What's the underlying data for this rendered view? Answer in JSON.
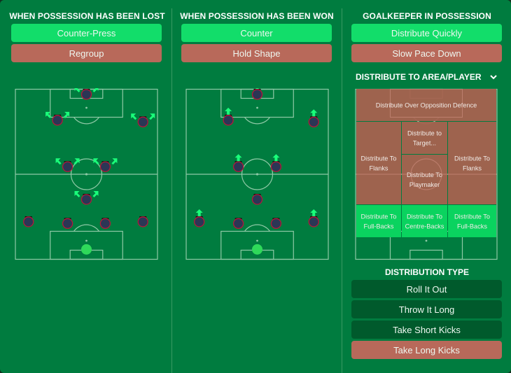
{
  "colors": {
    "background": "#007c3f",
    "selected": "#12dd6a",
    "unselected": "#b8695a",
    "neutral": "#005a2c",
    "pitch_line": "#8fc9a6",
    "player_fill": "#2b3655",
    "player_ring": "#b3183a",
    "gk_fill": "#2fd95a",
    "arrow": "#1aff7a"
  },
  "lost": {
    "title": "WHEN POSSESSION HAS BEEN LOST",
    "options": [
      {
        "label": "Counter-Press",
        "selected": true
      },
      {
        "label": "Regroup",
        "selected": false
      }
    ],
    "players": [
      {
        "role": "striker",
        "arrows": "diag"
      },
      {
        "role": "left-attacker",
        "arrows": "diag"
      },
      {
        "role": "right-attacker",
        "arrows": "diag"
      },
      {
        "role": "left-centre-mid",
        "arrows": "diag"
      },
      {
        "role": "right-centre-mid",
        "arrows": "diag"
      },
      {
        "role": "defensive-mid",
        "arrows": "diag"
      },
      {
        "role": "left-back",
        "arrows": "none"
      },
      {
        "role": "left-centre-back",
        "arrows": "none"
      },
      {
        "role": "right-centre-back",
        "arrows": "none"
      },
      {
        "role": "right-back",
        "arrows": "none"
      },
      {
        "role": "goalkeeper",
        "arrows": "none"
      }
    ]
  },
  "won": {
    "title": "WHEN POSSESSION HAS BEEN WON",
    "options": [
      {
        "label": "Counter",
        "selected": true
      },
      {
        "label": "Hold Shape",
        "selected": false
      }
    ],
    "players": [
      {
        "role": "striker",
        "arrows": "up"
      },
      {
        "role": "left-attacker",
        "arrows": "up"
      },
      {
        "role": "right-attacker",
        "arrows": "up"
      },
      {
        "role": "left-centre-mid",
        "arrows": "up"
      },
      {
        "role": "right-centre-mid",
        "arrows": "up"
      },
      {
        "role": "defensive-mid",
        "arrows": "none"
      },
      {
        "role": "left-back",
        "arrows": "up"
      },
      {
        "role": "left-centre-back",
        "arrows": "none"
      },
      {
        "role": "right-centre-back",
        "arrows": "none"
      },
      {
        "role": "right-back",
        "arrows": "up"
      },
      {
        "role": "goalkeeper",
        "arrows": "none"
      }
    ]
  },
  "goalkeeper": {
    "title": "GOALKEEPER IN POSSESSION",
    "options": [
      {
        "label": "Distribute Quickly",
        "selected": true
      },
      {
        "label": "Slow Pace Down",
        "selected": false
      }
    ],
    "distribute_area": {
      "title": "DISTRIBUTE TO AREA/PLAYER",
      "chevron_icon": "chevron-down-icon",
      "zones": {
        "over_defence": {
          "lines": [
            "Distribute Over Opposition Defence"
          ],
          "selected": false
        },
        "left_flank": {
          "lines": [
            "Distribute To",
            "Flanks"
          ],
          "selected": false
        },
        "target": {
          "lines": [
            "Distribute to",
            "Target..."
          ],
          "selected": false
        },
        "playmaker": {
          "lines": [
            "Distribute To",
            "Playmaker"
          ],
          "selected": false
        },
        "right_flank": {
          "lines": [
            "Distribute To",
            "Flanks"
          ],
          "selected": false
        },
        "left_fullback": {
          "lines": [
            "Distribute To",
            "Full-Backs"
          ],
          "selected": true
        },
        "centre_backs": {
          "lines": [
            "Distribute To",
            "Centre-Backs"
          ],
          "selected": true
        },
        "right_fullback": {
          "lines": [
            "Distribute To",
            "Full-Backs"
          ],
          "selected": true
        }
      }
    },
    "distribution_type": {
      "title": "DISTRIBUTION TYPE",
      "options": [
        {
          "label": "Roll It Out",
          "state": "neutral"
        },
        {
          "label": "Throw It Long",
          "state": "neutral"
        },
        {
          "label": "Take Short Kicks",
          "state": "neutral"
        },
        {
          "label": "Take Long Kicks",
          "state": "unselected"
        }
      ]
    }
  }
}
